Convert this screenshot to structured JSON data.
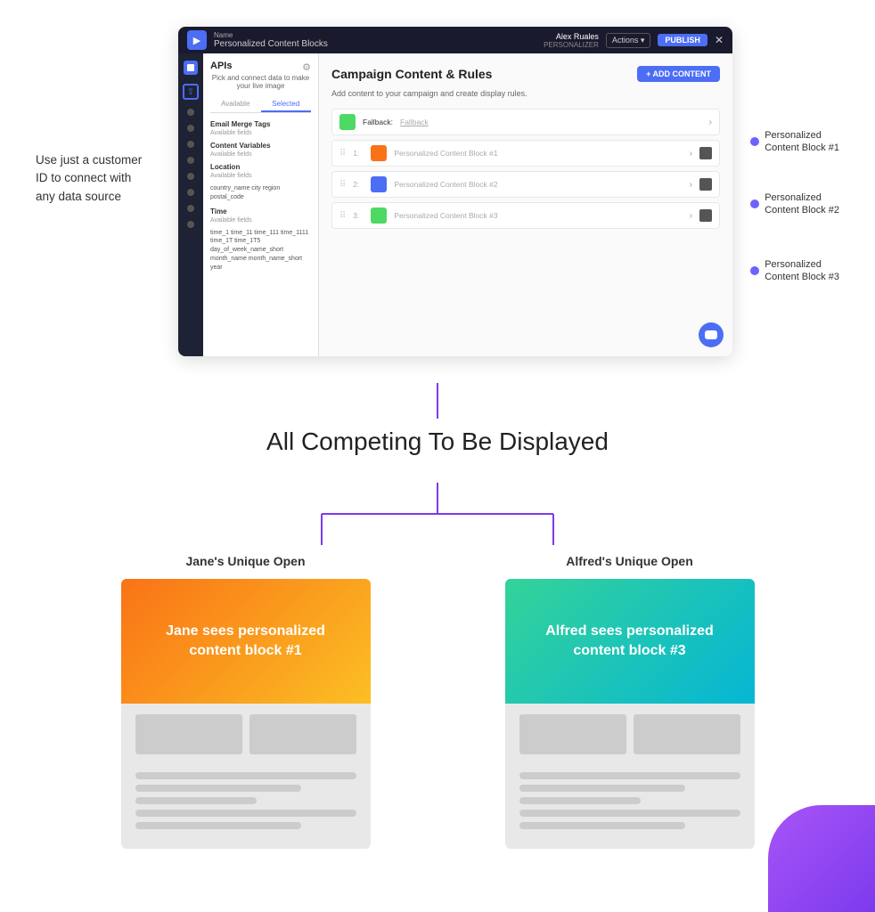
{
  "page": {
    "background": "#ffffff"
  },
  "sidebar_annotation": {
    "line1": "Use just a customer",
    "line2": "ID to connect with",
    "line3": "any data source"
  },
  "mockup": {
    "topbar": {
      "title": "Personalized Content Blocks",
      "user_name": "Alex Ruales",
      "user_role": "PERSONALIZER",
      "actions_label": "Actions ▾",
      "publish_label": "PUBLISH",
      "close_label": "✕"
    },
    "api_panel": {
      "title": "APIs",
      "subtitle": "Pick and connect data to make your live image",
      "tab_available": "Available",
      "tab_selected": "Selected",
      "section1_title": "Email Merge Tags",
      "section1_sub": "Available fields",
      "section2_title": "Content Variables",
      "section2_sub": "Available fields",
      "section3_title": "Location",
      "section3_sub": "Available fields",
      "section3_vars": "country_name  city  region\npostal_code",
      "section4_title": "Time",
      "section4_sub": "Available fields",
      "section4_vars": "time_1  time_11  time_111  time_1111\ntime_1T  time_1T5  day_of_week_name_short  month_name\nmonth_name_short  year"
    },
    "campaign": {
      "title": "Campaign Content & Rules",
      "subtitle": "Add content to your campaign and create display rules.",
      "add_content_label": "+ ADD CONTENT",
      "rows": [
        {
          "label": "Fallback:",
          "value": "Fallback",
          "color": "#4cd964",
          "num": ""
        },
        {
          "label": "1:",
          "value": "Personalized Content Block #1",
          "color": "#f97316",
          "num": "1"
        },
        {
          "label": "2:",
          "value": "Personalized Content Block #2",
          "color": "#4c6ef5",
          "num": "2"
        },
        {
          "label": "3:",
          "value": "Personalized Content Block #3",
          "color": "#4cd964",
          "num": "3"
        }
      ]
    },
    "annotations": [
      {
        "id": 1,
        "label": "Personalized\nContent Block #1",
        "top_pct": 22
      },
      {
        "id": 2,
        "label": "Personalized\nContent Block #2",
        "top_pct": 42
      },
      {
        "id": 3,
        "label": "Personalized\nContent Block #3",
        "top_pct": 65
      }
    ]
  },
  "competing_title": "All Competing To Be Displayed",
  "jane": {
    "label": "Jane's Unique Open",
    "hero_text": "Jane sees personalized content block #1"
  },
  "alfred": {
    "label": "Alfred's Unique Open",
    "hero_text": "Alfred sees personalized content block #3"
  }
}
